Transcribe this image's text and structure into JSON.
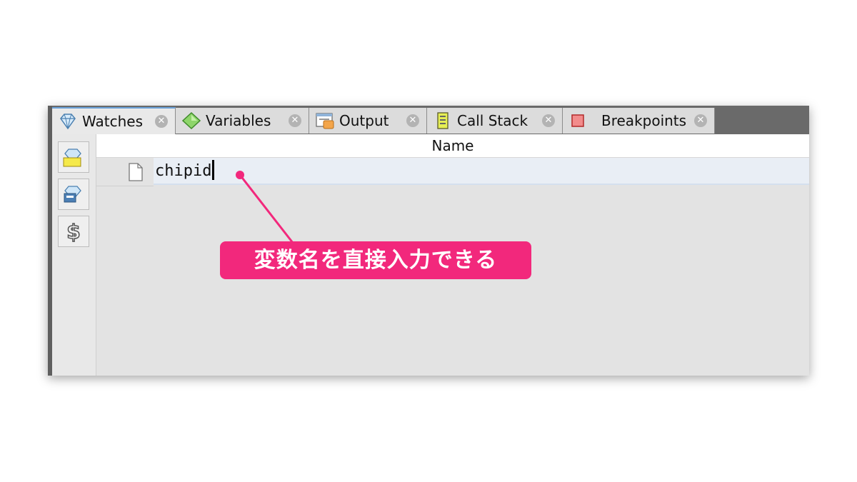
{
  "tabs": [
    {
      "label": "Watches",
      "icon": "diamond-icon",
      "active": true
    },
    {
      "label": "Variables",
      "icon": "green-diamond-icon",
      "active": false
    },
    {
      "label": "Output",
      "icon": "output-console-icon",
      "active": false
    },
    {
      "label": "Call Stack",
      "icon": "call-stack-icon",
      "active": false
    },
    {
      "label": "Breakpoints",
      "icon": "breakpoint-icon",
      "active": false
    }
  ],
  "tab_close_glyph": "✕",
  "toolbar": {
    "buttons": [
      {
        "icon": "new-watch-icon"
      },
      {
        "icon": "edit-watch-icon"
      },
      {
        "icon": "dollar-icon",
        "glyph": "$"
      }
    ]
  },
  "table": {
    "column_header": "Name",
    "rows": [
      {
        "icon": "file-icon",
        "value": "chipid"
      }
    ]
  },
  "annotation": {
    "text": "変数名を直接入力できる",
    "color": "#f2287c"
  }
}
